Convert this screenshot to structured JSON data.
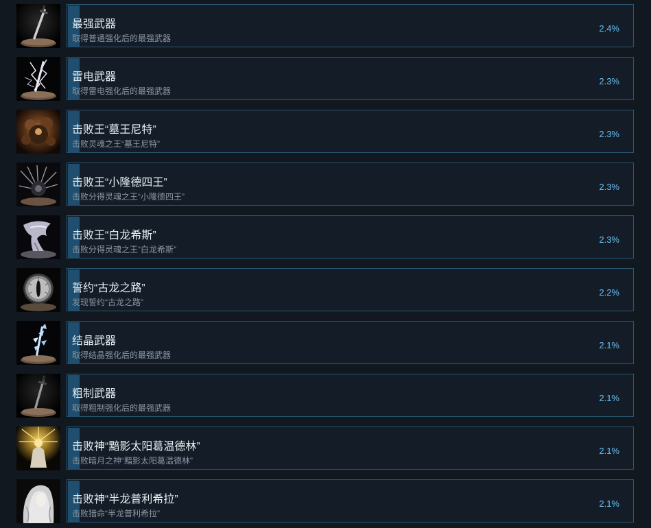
{
  "achievements": [
    {
      "icon": "sword-on-pedestal-icon",
      "title": "最强武器",
      "description": "取得普通强化后的最强武器",
      "percent": "2.4%"
    },
    {
      "icon": "lightning-sword-icon",
      "title": "雷电武器",
      "description": "取得雷电强化后的最强武器",
      "percent": "2.3%"
    },
    {
      "icon": "gravelord-nito-icon",
      "title": "击败王“墓王尼特”",
      "description": "击败灵魂之王“墓王尼特”",
      "percent": "2.3%"
    },
    {
      "icon": "four-kings-icon",
      "title": "击败王“小隆德四王”",
      "description": "击败分得灵魂之王“小隆德四王”",
      "percent": "2.3%"
    },
    {
      "icon": "seath-dragon-icon",
      "title": "击败王“白龙希斯”",
      "description": "击败分得灵魂之王“白龙希斯”",
      "percent": "2.3%"
    },
    {
      "icon": "dragon-eye-icon",
      "title": "誓约“古龙之路”",
      "description": "发现誓约“古龙之路”",
      "percent": "2.2%"
    },
    {
      "icon": "crystal-weapon-icon",
      "title": "结晶武器",
      "description": "取得结晶强化后的最强武器",
      "percent": "2.1%"
    },
    {
      "icon": "raw-sword-icon",
      "title": "粗制武器",
      "description": "取得粗制强化后的最强武器",
      "percent": "2.1%"
    },
    {
      "icon": "gwyndolin-icon",
      "title": "击败神“黯影太阳葛温德林”",
      "description": "击败暗月之神“黯影太阳葛温德林”",
      "percent": "2.1%"
    },
    {
      "icon": "priscilla-icon",
      "title": "击败神“半龙普利希拉”",
      "description": "击败猎命“半龙普利希拉”",
      "percent": "2.1%"
    }
  ],
  "colors": {
    "background": "#111820",
    "panel": "#141d27",
    "panel_border": "#2a5772",
    "accent_bar": "#1f4e6e",
    "percent_text": "#66c0f4"
  }
}
